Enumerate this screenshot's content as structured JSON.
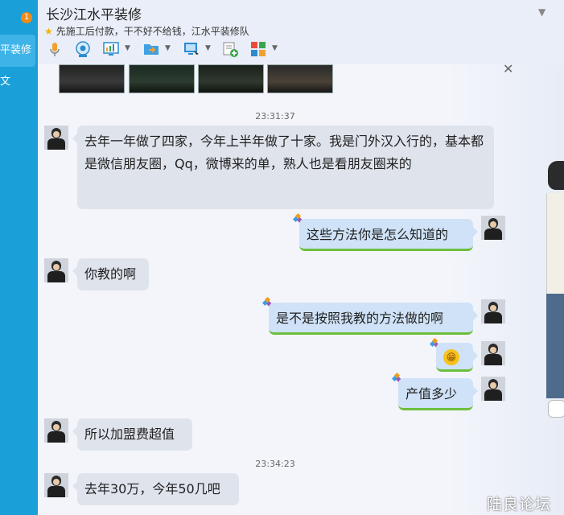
{
  "sidebar": {
    "badge_count": "1",
    "active_item": "平装修",
    "second_item": "文"
  },
  "header": {
    "title": "长沙江水平装修",
    "signature": "先施工后付款，干不好不给钱，江水平装修队"
  },
  "toolbar": {
    "buttons": [
      "mic-icon",
      "video-call-icon",
      "screen-share-icon",
      "send-file-icon",
      "remote-desktop-icon",
      "new-note-icon",
      "app-grid-icon"
    ]
  },
  "messages": {
    "ts1": "23:31:37",
    "m1": "去年一年做了四家，今年上半年做了十家。我是门外汉入行的，基本都是微信朋友圈，Qq，微博来的单，熟人也是看朋友圈来的",
    "m2": "这些方法你是怎么知道的",
    "m3": "你教的啊",
    "m4": "是不是按照我教的方法做的啊",
    "m5_emoji": "😁",
    "m6": "产值多少",
    "m7": "所以加盟费超值",
    "ts2": "23:34:23",
    "m8": "去年30万，今年50几吧"
  },
  "watermark": "陆良论坛",
  "colors": {
    "sidebar": "#1a9fd9",
    "bubble_left": "#dfe3ec",
    "bubble_right": "#cfe2f7",
    "bubble_right_border": "#6cbf3d",
    "badge": "#f08a18"
  }
}
